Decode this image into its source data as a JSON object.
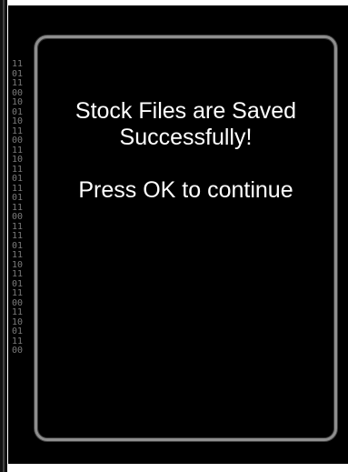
{
  "binary_pattern": [
    "11",
    "01",
    "11",
    "00",
    "10",
    "01",
    "10",
    "11",
    "00",
    "11",
    "10",
    "11",
    "01",
    "11",
    "01",
    "11",
    "00",
    "11",
    "11",
    "01",
    "11",
    "10",
    "11",
    "01",
    "11",
    "00",
    "11",
    "10",
    "01",
    "11",
    "00"
  ],
  "dialog": {
    "line1": "Stock Files are Saved",
    "line2": "Successfully!",
    "line3": "Press OK to continue"
  },
  "colors": {
    "screen_bg": "#000000",
    "dialog_border": "#8e8e8e",
    "text": "#ffffff"
  }
}
